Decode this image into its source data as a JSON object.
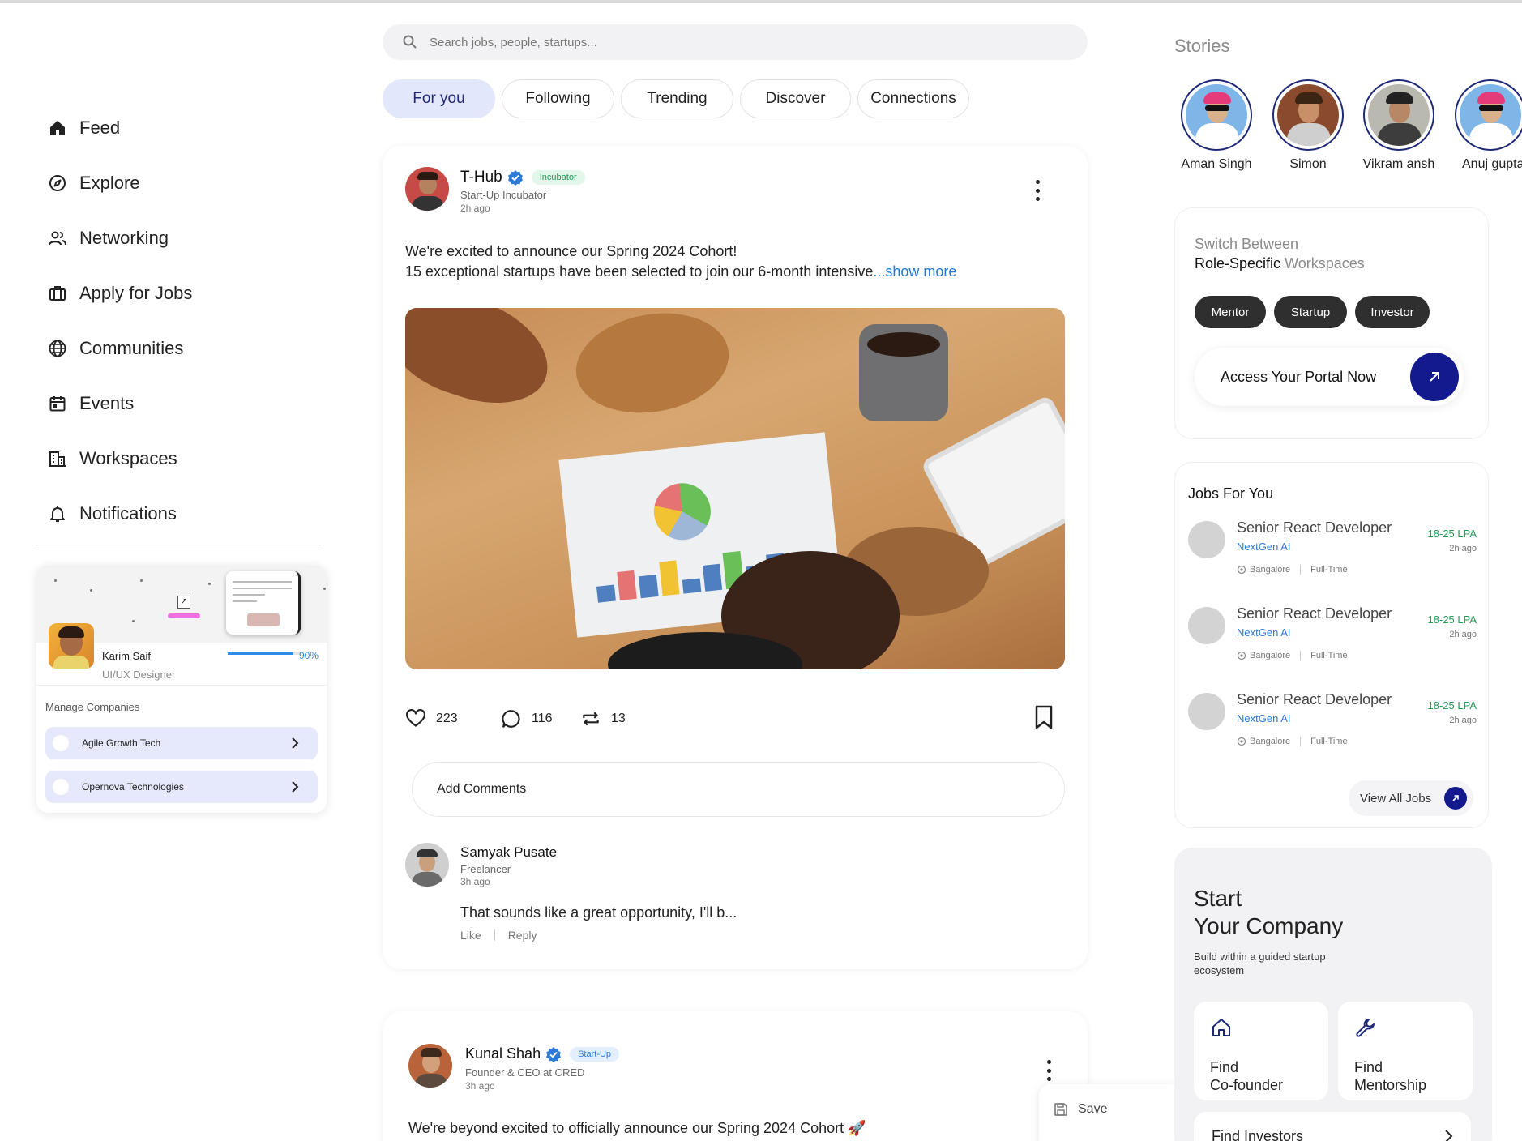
{
  "search": {
    "placeholder": "Search jobs, people, startups..."
  },
  "nav": {
    "items": [
      {
        "label": "Feed",
        "icon": "home-icon"
      },
      {
        "label": "Explore",
        "icon": "compass-icon"
      },
      {
        "label": "Networking",
        "icon": "people-icon"
      },
      {
        "label": "Apply for Jobs",
        "icon": "briefcase-icon"
      },
      {
        "label": "Communities",
        "icon": "globe-icon"
      },
      {
        "label": "Events",
        "icon": "calendar-icon"
      },
      {
        "label": "Workspaces",
        "icon": "building-icon"
      },
      {
        "label": "Notifications",
        "icon": "bell-icon"
      }
    ]
  },
  "profile": {
    "name": "Karim Saif",
    "role": "UI/UX Designer",
    "progress": 0.9,
    "progress_label": "90%",
    "manage_label": "Manage Companies",
    "companies": [
      "Agile Growth Tech",
      "Opernova Technologies"
    ]
  },
  "tabs": [
    "For you",
    "Following",
    "Trending",
    "Discover",
    "Connections"
  ],
  "post": {
    "author": "T-Hub",
    "badge": "Incubator",
    "subtitle": "Start-Up Incubator",
    "time": "2h ago",
    "line1": "We're excited to announce our Spring 2024 Cohort!",
    "line2": "15 exceptional startups have been selected to join our 6-month intensive",
    "show_more": "...show more",
    "likes": "223",
    "comments": "116",
    "reposts": "13",
    "comment_placeholder": "Add Comments"
  },
  "comment": {
    "author": "Samyak Pusate",
    "subtitle": "Freelancer",
    "time": "3h ago",
    "text": "That sounds like a great opportunity, I'll b...",
    "like": "Like",
    "reply": "Reply"
  },
  "post2": {
    "author": "Kunal Shah",
    "badge": "Start-Up",
    "subtitle": "Founder & CEO at CRED",
    "time": "3h ago",
    "text": "We're beyond excited to officially announce our Spring 2024 Cohort 🚀"
  },
  "save_menu": {
    "label": "Save"
  },
  "stories": {
    "title": "Stories",
    "people": [
      "Aman Singh",
      "Simon",
      "Vikram ansh",
      "Anuj gupta"
    ]
  },
  "workspaces": {
    "line1": "Switch Between",
    "line2_bold": "Role-Specific",
    "line2_light": "Workspaces",
    "roles": [
      "Mentor",
      "Startup",
      "Investor"
    ],
    "cta": "Access Your Portal Now"
  },
  "jobs": {
    "title": "Jobs For You",
    "items": [
      {
        "title": "Senior React Developer",
        "company": "NextGen AI",
        "location": "Bangalore",
        "type": "Full-Time",
        "salary": "18-25 LPA",
        "ago": "2h ago"
      },
      {
        "title": "Senior React Developer",
        "company": "NextGen AI",
        "location": "Bangalore",
        "type": "Full-Time",
        "salary": "18-25 LPA",
        "ago": "2h ago"
      },
      {
        "title": "Senior React Developer",
        "company": "NextGen AI",
        "location": "Bangalore",
        "type": "Full-Time",
        "salary": "18-25 LPA",
        "ago": "2h ago"
      }
    ],
    "view_all": "View All Jobs"
  },
  "start_company": {
    "title_line1": "Start",
    "title_line2": "Your Company",
    "subtitle": "Build within a guided startup ecosystem",
    "tiles": [
      {
        "line1": "Find",
        "line2": "Co-founder",
        "icon": "house-icon"
      },
      {
        "line1": "Find",
        "line2": "Mentorship",
        "icon": "wrench-icon"
      }
    ],
    "investors": "Find Investors"
  },
  "colors": {
    "accent_navy": "#121a8e",
    "tab_active_bg": "#e3e7fb",
    "link_blue": "#1f7ae0",
    "salary_green": "#1f9d55"
  }
}
